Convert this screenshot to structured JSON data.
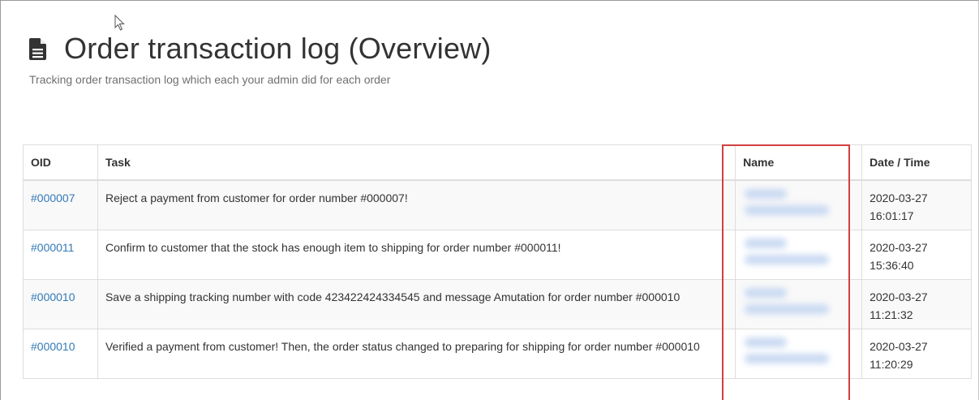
{
  "page": {
    "title": "Order transaction log (Overview)",
    "subtitle": "Tracking order transaction log which each your admin did for each order",
    "title_icon": "file-text-icon"
  },
  "table": {
    "columns": {
      "oid": "OID",
      "task": "Task",
      "name": "Name",
      "datetime": "Date / Time"
    },
    "rows": [
      {
        "oid": "#000007",
        "task": "Reject a payment from customer for order number #000007!",
        "name": "",
        "date": "2020-03-27",
        "time": "16:01:17"
      },
      {
        "oid": "#000011",
        "task": "Confirm to customer that the stock has enough item to shipping for order number #000011!",
        "name": "",
        "date": "2020-03-27",
        "time": "15:36:40"
      },
      {
        "oid": "#000010",
        "task": "Save a shipping tracking number with code 423422424334545 and message Amutation for order number #000010",
        "name": "",
        "date": "2020-03-27",
        "time": "11:21:32"
      },
      {
        "oid": "#000010",
        "task": "Verified a payment from customer! Then, the order status changed to preparing for shipping for order number #000010",
        "name": "",
        "date": "2020-03-27",
        "time": "11:20:29"
      }
    ]
  },
  "colors": {
    "link": "#337ab7",
    "highlight_border": "#d24040",
    "stripe": "#f9f9f9"
  }
}
